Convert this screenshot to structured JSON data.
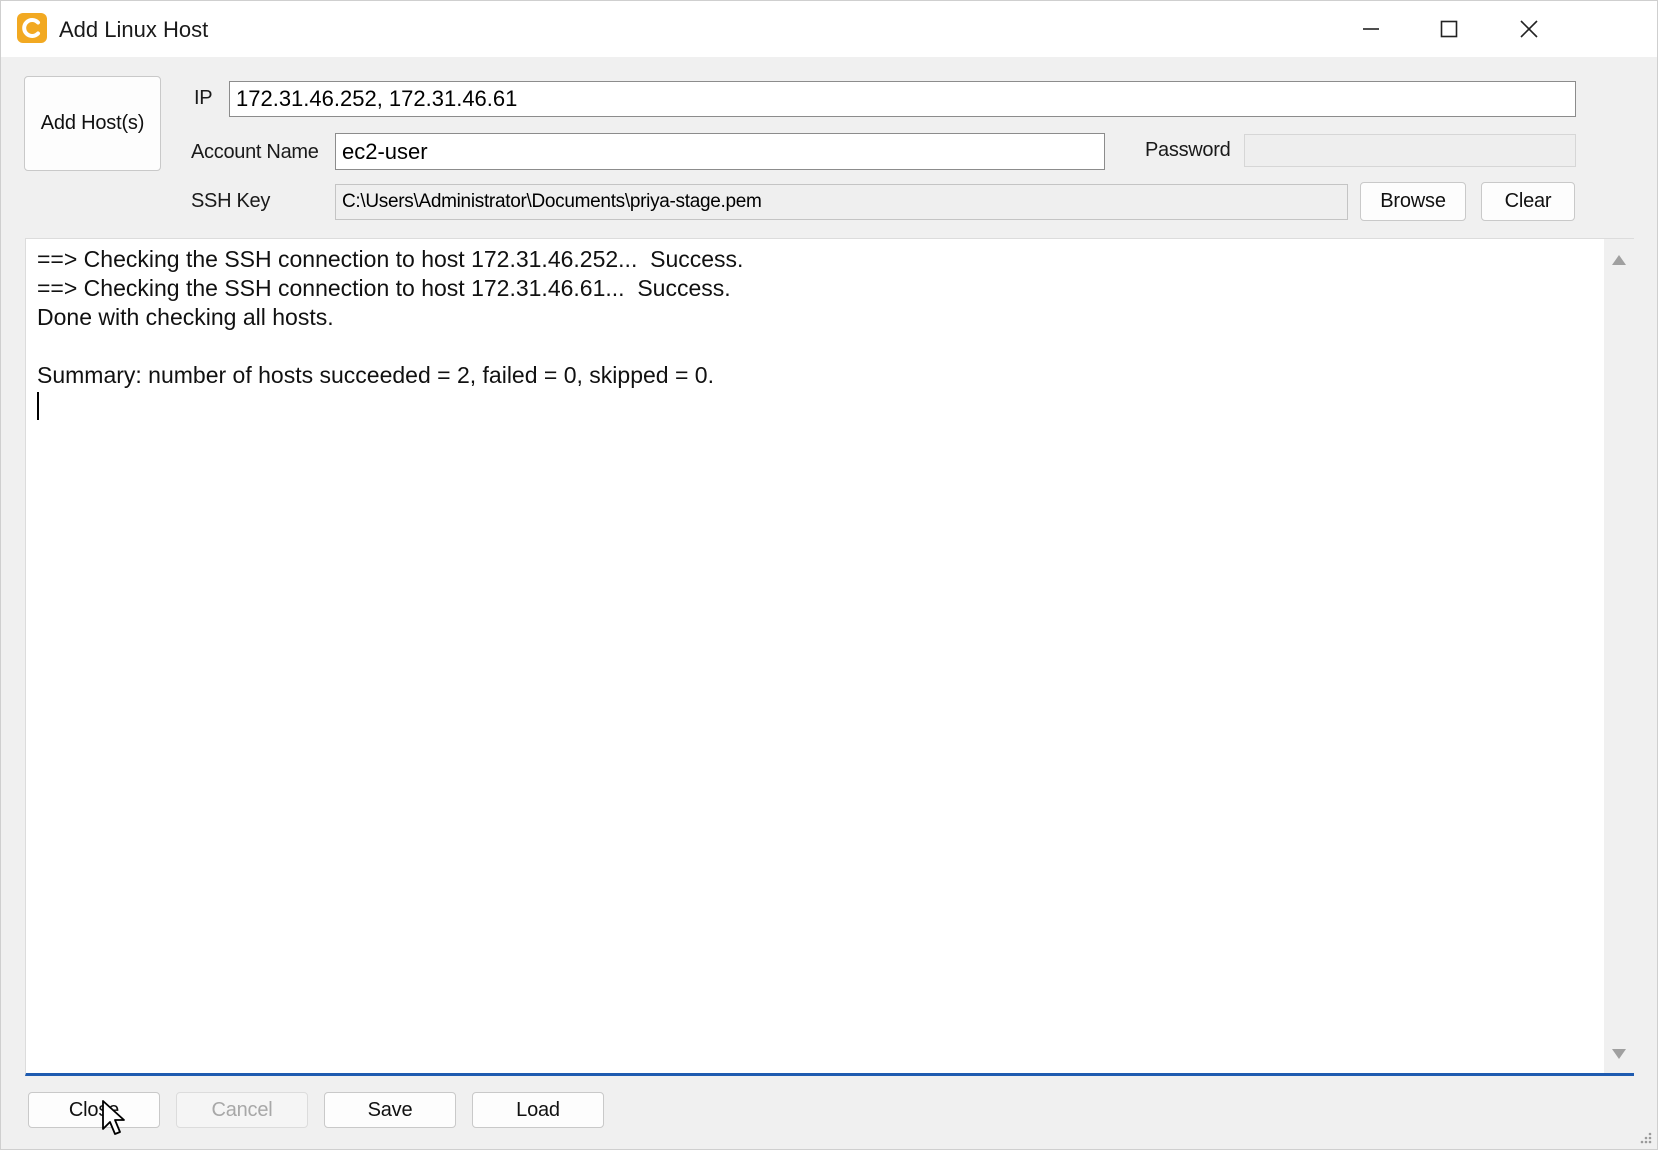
{
  "window": {
    "title": "Add Linux Host",
    "icon": "app-logo-icon",
    "controls": [
      "minimize-icon",
      "maximize-icon",
      "close-icon"
    ]
  },
  "form": {
    "add_hosts_label": "Add Host(s)",
    "ip_label": "IP",
    "ip_value": "172.31.46.252, 172.31.46.61",
    "account_label": "Account Name",
    "account_value": "ec2-user",
    "password_label": "Password",
    "password_value": "",
    "sshkey_label": "SSH Key",
    "sshkey_value": "C:\\Users\\Administrator\\Documents\\priya-stage.pem",
    "browse_label": "Browse",
    "clear_label": "Clear"
  },
  "log": {
    "lines": [
      "==> Checking the SSH connection to host 172.31.46.252...  Success.",
      "==> Checking the SSH connection to host 172.31.46.61...  Success.",
      "Done with checking all hosts.",
      "",
      "Summary: number of hosts succeeded = 2, failed = 0, skipped = 0."
    ]
  },
  "footer": {
    "close_label": "Close",
    "cancel_label": "Cancel",
    "save_label": "Save",
    "load_label": "Load"
  },
  "colors": {
    "accent": "#1e5bb0",
    "app_icon": "#f2a922"
  }
}
